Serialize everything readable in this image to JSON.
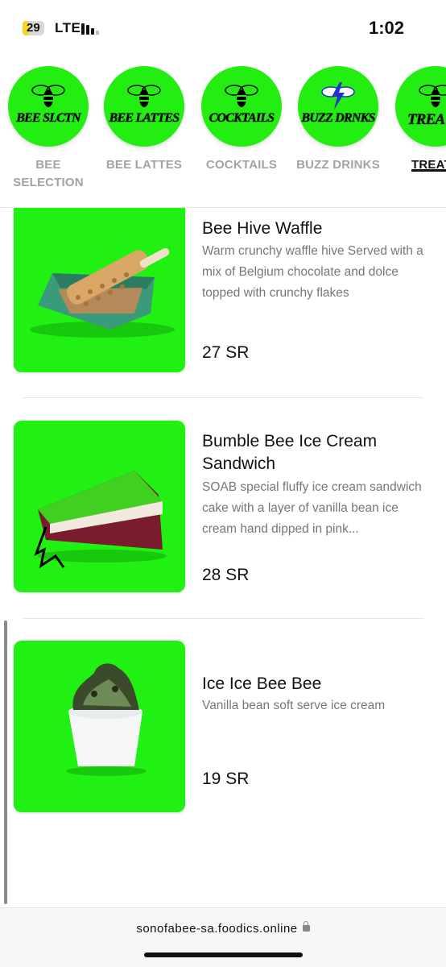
{
  "status_bar": {
    "battery_level": "29",
    "battery_fraction": 0.29,
    "network": "LTE",
    "time": "1:02"
  },
  "categories": [
    {
      "logo_text": "BEE SLCTN",
      "label": "BEE\nSELECTION",
      "icon": "bee-icon",
      "active": false
    },
    {
      "logo_text": "BEE LATTES",
      "label": "BEE LATTES",
      "icon": "bee-icon",
      "active": false
    },
    {
      "logo_text": "COCKTAILS",
      "label": "COCKTAILS",
      "icon": "bee-icon",
      "active": false
    },
    {
      "logo_text": "BUZZ DRNKS",
      "label": "BUZZ DRINKS",
      "icon": "lightning-bee-icon",
      "active": false
    },
    {
      "logo_text": "TREA",
      "label": "TREAT",
      "icon": "bee-icon",
      "active": true
    }
  ],
  "products": [
    {
      "name": "Bee Hive Waffle",
      "description": "Warm crunchy waffle hive Served with a mix of Belgium chocolate and dolce topped with crunchy flakes",
      "price": "27 SR"
    },
    {
      "name": "Bumble Bee Ice Cream Sandwich",
      "description": "SOAB special fluffy ice cream sandwich cake with a layer of vanilla bean ice cream hand dipped in pink...",
      "price": "28 SR"
    },
    {
      "name": "Ice Ice Bee Bee",
      "description": "Vanilla bean soft serve ice cream",
      "price": "19 SR"
    }
  ],
  "url_bar": {
    "url": "sonofabee-sa.foodics.online"
  },
  "colors": {
    "brand_green": "#22ee11",
    "text": "#111111",
    "muted": "#777777",
    "inactive_tab": "#a3a3a3"
  }
}
